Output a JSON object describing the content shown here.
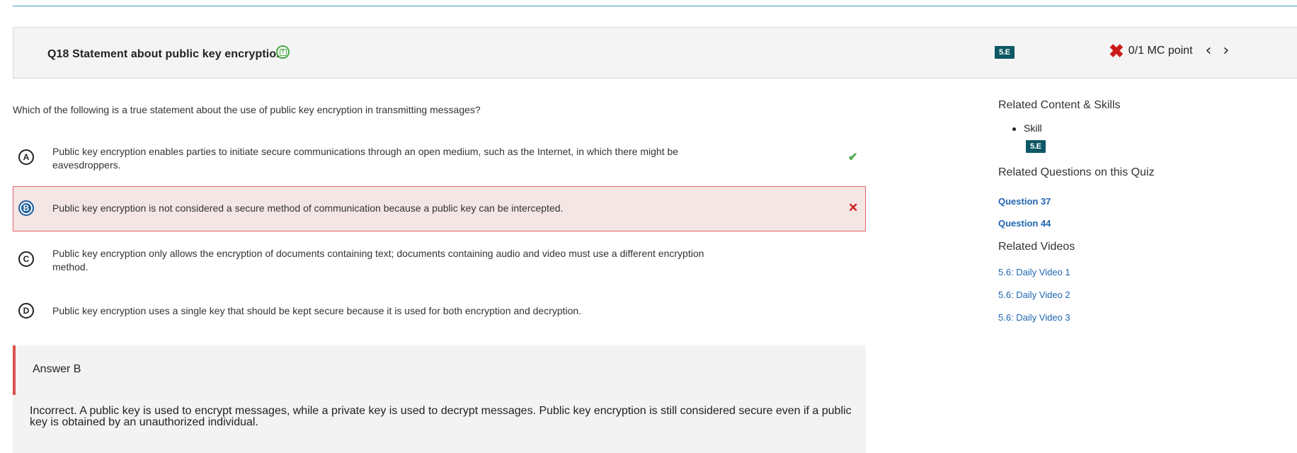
{
  "question": {
    "title": "Q18 Statement about public key encryption",
    "skill_badge": "5.E",
    "score": "0/1 MC point",
    "prompt": "Which of the following is a true statement about the use of public key encryption in transmitting messages?",
    "choices": [
      {
        "letter": "A",
        "text": "Public key encryption enables parties to initiate secure communications through an open medium, such as the Internet, in which there might be eavesdroppers.",
        "mark": "✔"
      },
      {
        "letter": "B",
        "text": "Public key encryption is not considered a secure method of communication because a public key can be intercepted.",
        "mark": "✕"
      },
      {
        "letter": "C",
        "text": "Public key encryption only allows the encryption of documents containing text; documents containing audio and video must use a different encryption method.",
        "mark": ""
      },
      {
        "letter": "D",
        "text": "Public key encryption uses a single key that should be kept secure because it is used for both encryption and decryption.",
        "mark": ""
      }
    ],
    "selected_choice": "B",
    "correct_choice": "A"
  },
  "answer": {
    "label": "Answer B",
    "explanation": "Incorrect. A public key is used to encrypt messages, while a private key is used to decrypt messages. Public key encryption is still considered secure even if a public key is obtained by an unauthorized individual."
  },
  "sidebar": {
    "related_content_heading": "Related Content & Skills",
    "skill_label": "Skill",
    "skill_badge": "5.E",
    "related_questions_heading": "Related Questions on this Quiz",
    "related_questions": [
      "Question 37",
      "Question 44"
    ],
    "related_videos_heading": "Related Videos",
    "related_videos": [
      "5.6: Daily Video 1",
      "5.6: Daily Video 2",
      "5.6: Daily Video 3"
    ]
  },
  "colors": {
    "accent_line": "#3a9fc2",
    "badge_bg": "#0d5865",
    "correct": "#4aa64a",
    "incorrect": "#cc1a1a",
    "link": "#1e66b0",
    "selected_choice": "#1d5d9c"
  },
  "icons": {
    "help": "help-icon",
    "score_status": "x-icon",
    "prev": "chevron-left-icon",
    "next": "chevron-right-icon",
    "correct_mark": "checkmark-icon",
    "wrong_mark": "close-icon"
  }
}
